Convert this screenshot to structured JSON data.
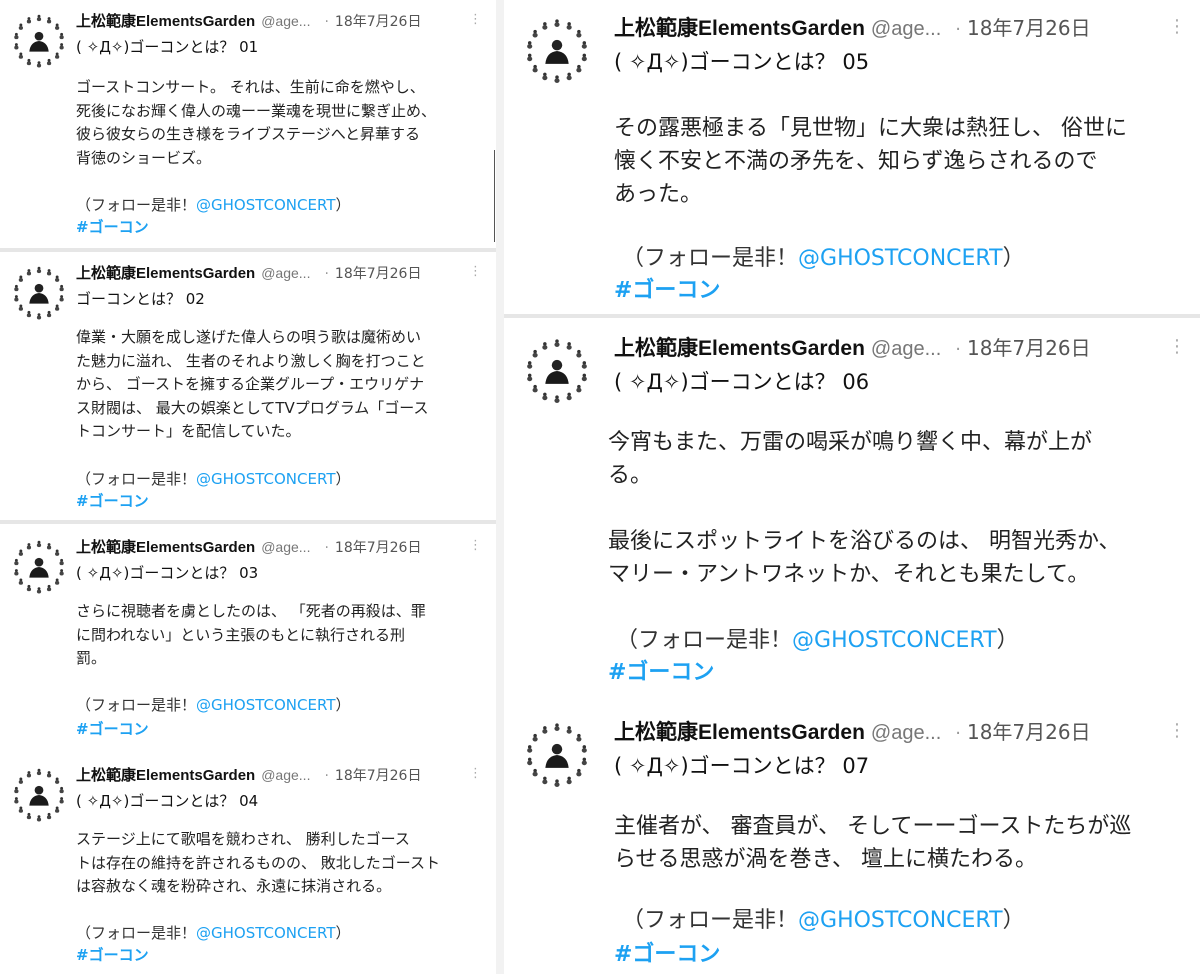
{
  "author": {
    "name": "上松範康ElementsGarden",
    "handle": "@age...",
    "dot": "·",
    "date": "18年7月26日",
    "menu_icon": "⋮"
  },
  "follow": {
    "prefix": "（フォロー是非！",
    "mention": "@GHOSTCONCERT",
    "suffix": "）"
  },
  "hashtag": "#ゴーコン",
  "tweets": [
    {
      "title": "( ✧Д✧)ゴーコンとは？ 01",
      "body": "ゴーストコンサート。 それは、生前に命を燃やし、\n死後になお輝く偉人の魂ーー業魂を現世に繋ぎ止め、\n彼ら彼女らの生き様をライブステージへと昇華する\n背徳のショービズ。"
    },
    {
      "title": "ゴーコンとは？ 02",
      "body": "偉業・大願を成し遂げた偉人らの唄う歌は魔術めい\nた魅力に溢れ、 生者のそれより激しく胸を打つこと\nから、 ゴーストを擁する企業グループ・エウリゲナ\nス財閥は、 最大の娯楽としてTVプログラム「ゴース\nトコンサート」を配信していた。"
    },
    {
      "title": "( ✧Д✧)ゴーコンとは？ 03",
      "body": " さらに視聴者を虜としたのは、 「死者の再殺は、罪\nに問われない」という主張のもとに執行される刑\n罰。"
    },
    {
      "title": "( ✧Д✧)ゴーコンとは？ 04",
      "body": " ステージ上にて歌唱を競わされ、 勝利したゴース\nトは存在の維持を許されるものの、 敗北したゴースト\nは容赦なく魂を粉砕され、永遠に抹消される。"
    },
    {
      "title": "( ✧Д✧)ゴーコンとは？ 05",
      "body": "その露悪極まる「見世物」に大衆は熱狂し、 俗世に\n懐く不安と不満の矛先を、知らず逸らされるので\nあった。"
    },
    {
      "title": "( ✧Д✧)ゴーコンとは？ 06",
      "body": "今宵もまた、万雷の喝采が鳴り響く中、幕が上が\nる。\n\n最後にスポットライトを浴びるのは、 明智光秀か、\nマリー・アントワネットか、それとも果たして。"
    },
    {
      "title": "( ✧Д✧)ゴーコンとは？ 07",
      "body": " 主催者が、 審査員が、 そしてーーゴーストたちが巡\nらせる思惑が渦を巻き、 壇上に横たわる。"
    }
  ]
}
